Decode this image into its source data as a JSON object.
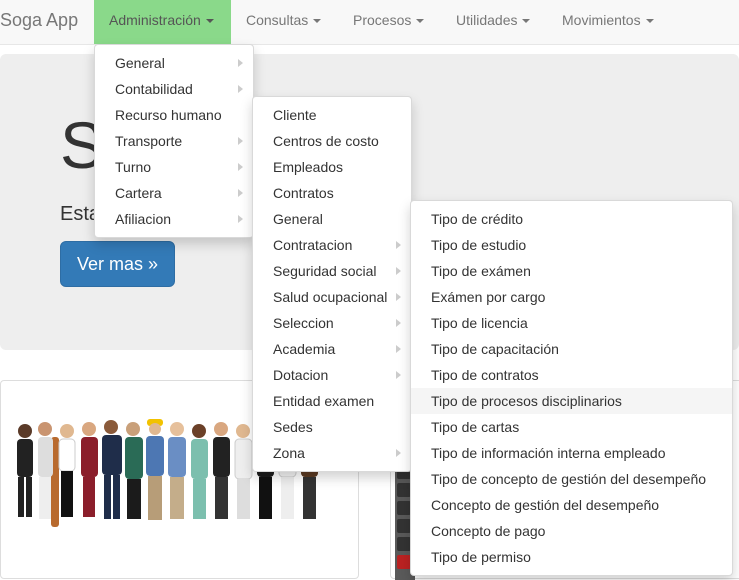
{
  "navbar": {
    "brand": "Soga App",
    "items": [
      {
        "label": "Administración"
      },
      {
        "label": "Consultas"
      },
      {
        "label": "Procesos"
      },
      {
        "label": "Utilidades"
      },
      {
        "label": "Movimientos"
      }
    ]
  },
  "jumbotron": {
    "title": "S",
    "subtitle": "Esta",
    "button_label": "Ver mas »"
  },
  "menus": {
    "administracion": {
      "items": [
        {
          "label": "General",
          "has_submenu": true
        },
        {
          "label": "Contabilidad",
          "has_submenu": true
        },
        {
          "label": "Recurso humano",
          "has_submenu": false
        },
        {
          "label": "Transporte",
          "has_submenu": true
        },
        {
          "label": "Turno",
          "has_submenu": true
        },
        {
          "label": "Cartera",
          "has_submenu": true
        },
        {
          "label": "Afiliacion",
          "has_submenu": true
        }
      ]
    },
    "recurso_humano": {
      "items": [
        {
          "label": "Cliente",
          "has_submenu": false
        },
        {
          "label": "Centros de costo",
          "has_submenu": false
        },
        {
          "label": "Empleados",
          "has_submenu": false
        },
        {
          "label": "Contratos",
          "has_submenu": false
        },
        {
          "label": "General",
          "has_submenu": false
        },
        {
          "label": "Contratacion",
          "has_submenu": true
        },
        {
          "label": "Seguridad social",
          "has_submenu": true
        },
        {
          "label": "Salud ocupacional",
          "has_submenu": true
        },
        {
          "label": "Seleccion",
          "has_submenu": true
        },
        {
          "label": "Academia",
          "has_submenu": true
        },
        {
          "label": "Dotacion",
          "has_submenu": true
        },
        {
          "label": "Entidad examen",
          "has_submenu": false
        },
        {
          "label": "Sedes",
          "has_submenu": false
        },
        {
          "label": "Zona",
          "has_submenu": true
        }
      ]
    },
    "general": {
      "highlighted_index": 7,
      "items": [
        {
          "label": "Tipo de crédito"
        },
        {
          "label": "Tipo de estudio"
        },
        {
          "label": "Tipo de exámen"
        },
        {
          "label": "Exámen por cargo"
        },
        {
          "label": "Tipo de licencia"
        },
        {
          "label": "Tipo de capacitación"
        },
        {
          "label": "Tipo de contratos"
        },
        {
          "label": "Tipo de procesos disciplinarios"
        },
        {
          "label": "Tipo de cartas"
        },
        {
          "label": "Tipo de información interna empleado"
        },
        {
          "label": "Tipo de concepto de gestión del desempeño"
        },
        {
          "label": "Concepto de gestión del desempeño"
        },
        {
          "label": "Concepto de pago"
        },
        {
          "label": "Tipo de permiso"
        }
      ]
    }
  },
  "colors": {
    "active_nav": "#8ad98a",
    "primary_button": "#337ab7",
    "jumbotron_bg": "#eeeeee"
  }
}
